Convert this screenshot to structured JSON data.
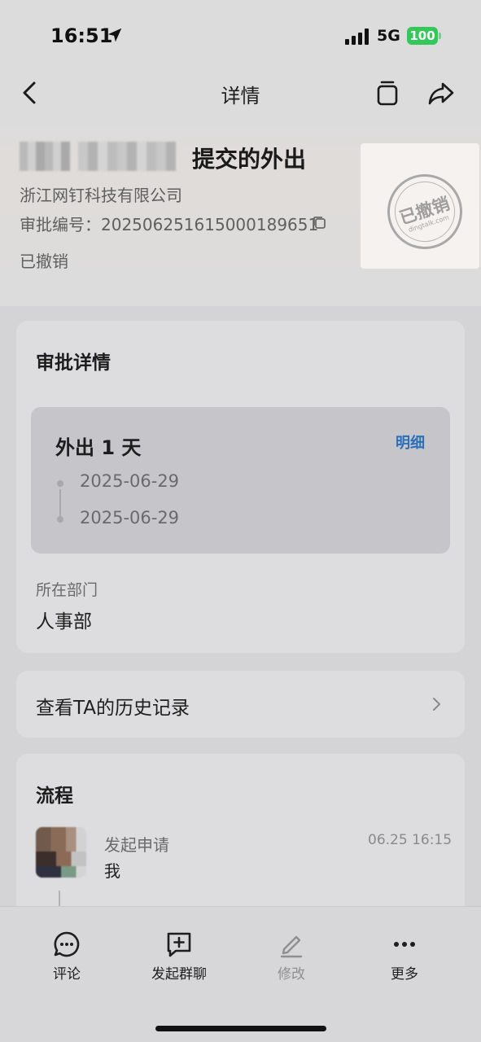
{
  "status_bar": {
    "time": "16:51",
    "network": "5G",
    "battery": "100"
  },
  "nav": {
    "title": "详情"
  },
  "header": {
    "title_suffix": "提交的外出",
    "company": "浙江网钉科技有限公司",
    "approval_number_label": "审批编号：",
    "approval_number": "202506251615000189651",
    "status": "已撤销",
    "stamp_text": "已撤销",
    "stamp_sub": "dingtalk.com"
  },
  "approval_details": {
    "title": "审批详情",
    "outing_summary": "外出 1 天",
    "detail_link": "明细",
    "start_date": "2025-06-29",
    "end_date": "2025-06-29",
    "department_label": "所在部门",
    "department_value": "人事部"
  },
  "history": {
    "label": "查看TA的历史记录"
  },
  "process": {
    "title": "流程",
    "steps": [
      {
        "action": "发起申请",
        "person": "我",
        "time": "06.25 16:15"
      }
    ]
  },
  "bottom_bar": {
    "comment": "评论",
    "group_chat": "发起群聊",
    "edit": "修改",
    "more": "更多"
  },
  "colors": {
    "accent": "#2b6fb8",
    "battery": "#34c759"
  }
}
